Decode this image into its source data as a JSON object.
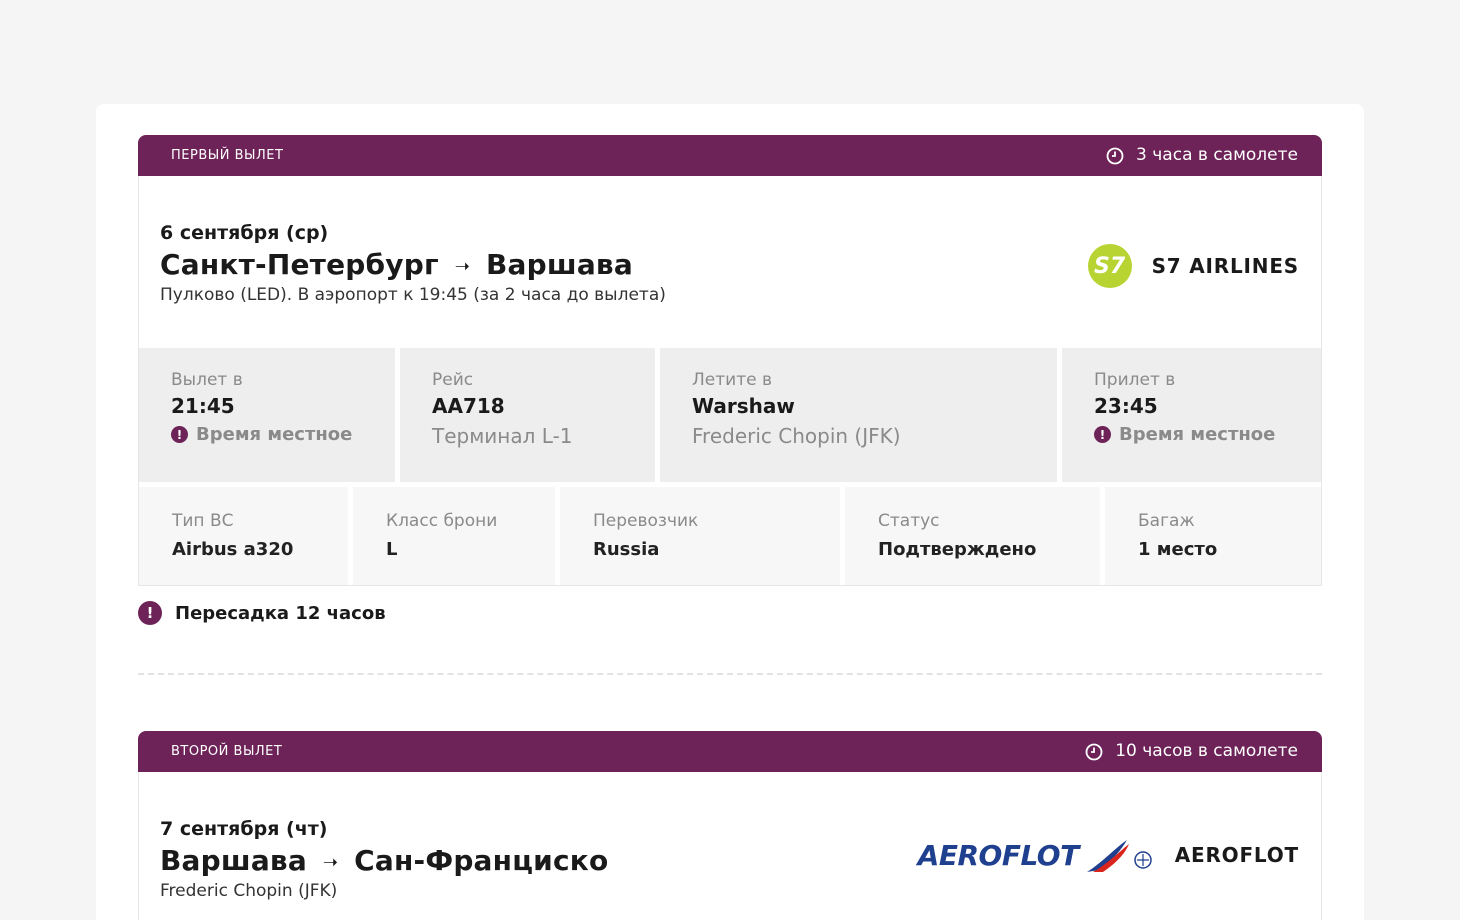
{
  "flights": [
    {
      "label": "ПЕРВЫЙ ВЫЛЕТ",
      "duration": "3 часа в самолете",
      "date": "6 сентября (ср)",
      "from": "Санкт-Петербург",
      "arrow": "➝",
      "to": "Варшава",
      "subtitle": "Пулково (LED). В аэропорт к 19:45 (за 2 часа до вылета)",
      "airline": {
        "name": "S7 AIRLINES",
        "logo_text": "S7",
        "logo_color": "#b8d433"
      },
      "departure": {
        "label": "Вылет в",
        "time": "21:45",
        "note": "Время местное"
      },
      "flight": {
        "label": "Рейс",
        "number": "AA718",
        "terminal": "Терминал L-1"
      },
      "destination": {
        "label": "Летите в",
        "city": "Warshaw",
        "airport": "Frederic Chopin (JFK)"
      },
      "arrival": {
        "label": "Прилет в",
        "time": "23:45",
        "note": "Время местное"
      },
      "details": {
        "aircraft": {
          "label": "Тип ВС",
          "value": "Airbus a320"
        },
        "class": {
          "label": "Класс брони",
          "value": "L"
        },
        "carrier": {
          "label": "Перевозчик",
          "value": "Russia"
        },
        "status": {
          "label": "Статус",
          "value": "Подтверждено"
        },
        "baggage": {
          "label": "Багаж",
          "value": "1 место"
        }
      }
    },
    {
      "label": "ВТОРОЙ ВЫЛЕТ",
      "duration": "10 часов в самолете",
      "date": "7 сентября (чт)",
      "from": "Варшава",
      "arrow": "➝",
      "to": "Сан-Франциско",
      "subtitle": "Frederic Chopin (JFK)",
      "airline": {
        "name": "AEROFLOT",
        "logo_text": "AEROFLOT",
        "logo_color": "#1f3f8f"
      }
    }
  ],
  "transfer": {
    "text": "Пересадка 12 часов",
    "icon": "exclamation-icon"
  },
  "colors": {
    "accent": "#6d2358",
    "background": "#f5f5f5"
  }
}
